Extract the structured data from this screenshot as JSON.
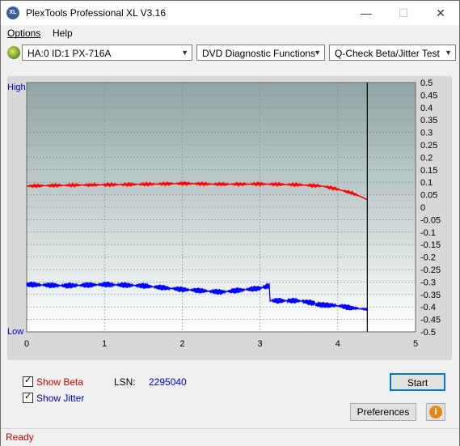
{
  "window": {
    "title": "PlexTools Professional XL V3.16",
    "app_icon": "XL"
  },
  "menu": {
    "items": [
      {
        "label": "Options",
        "accel": "O"
      },
      {
        "label": "Help",
        "accel": "H"
      }
    ]
  },
  "toolbar": {
    "drive": "HA:0 ID:1  PX-716A",
    "function": "DVD Diagnostic Functions",
    "test": "Q-Check Beta/Jitter Test"
  },
  "chart_data": {
    "type": "line",
    "x_ticks": [
      "0",
      "1",
      "2",
      "3",
      "4",
      "5"
    ],
    "xlim": [
      0,
      5
    ],
    "y_right_ticks": [
      "0.5",
      "0.45",
      "0.4",
      "0.35",
      "0.3",
      "0.25",
      "0.2",
      "0.15",
      "0.1",
      "0.05",
      "0",
      "-0.05",
      "-0.1",
      "-0.15",
      "-0.2",
      "-0.25",
      "-0.3",
      "-0.35",
      "-0.4",
      "-0.45",
      "-0.5"
    ],
    "ylim": [
      -0.5,
      0.5
    ],
    "y_left_labels": {
      "top": "High",
      "bottom": "Low"
    },
    "end_marker_x": 4.38,
    "grid": true,
    "series": [
      {
        "name": "Beta",
        "color": "#ff0000",
        "x": [
          0,
          0.5,
          1,
          1.5,
          2,
          2.5,
          3,
          3.5,
          3.8,
          4.0,
          4.2,
          4.3,
          4.38
        ],
        "y": [
          0.085,
          0.088,
          0.09,
          0.092,
          0.095,
          0.092,
          0.093,
          0.09,
          0.085,
          0.072,
          0.055,
          0.042,
          0.03
        ]
      },
      {
        "name": "Jitter",
        "color": "#0000ff",
        "x": [
          0,
          0.5,
          1,
          1.5,
          2,
          2.5,
          3.0,
          3.12,
          3.13,
          3.5,
          3.7,
          3.72,
          4.0,
          4.2,
          4.38
        ],
        "y": [
          -0.31,
          -0.315,
          -0.31,
          -0.315,
          -0.33,
          -0.34,
          -0.325,
          -0.315,
          -0.375,
          -0.375,
          -0.385,
          -0.39,
          -0.395,
          -0.405,
          -0.41
        ]
      }
    ]
  },
  "panel": {
    "show_beta": "Show Beta",
    "show_jitter": "Show Jitter",
    "lsn_label": "LSN:",
    "lsn_value": "2295040",
    "start_label": "Start",
    "preferences_label": "Preferences",
    "info_icon": "info-icon"
  },
  "status": {
    "text": "Ready"
  },
  "colors": {
    "beta": "#ff0000",
    "jitter": "#0000ff",
    "status_text": "#d00000",
    "label_blue": "#0000c0"
  }
}
